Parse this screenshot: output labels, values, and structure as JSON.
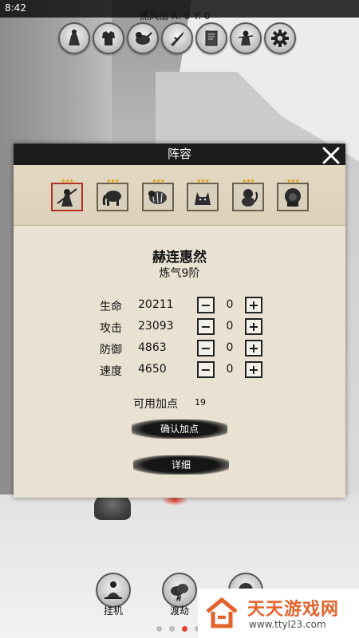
{
  "status": {
    "time": "8:42"
  },
  "map": {
    "location_label": "黑风山 X:  0 Y:  0"
  },
  "top_icons": [
    "hero-icon",
    "armor-icon",
    "beast-icon",
    "weapon-icon",
    "book-icon",
    "warrior-icon",
    "gear-icon"
  ],
  "panel": {
    "title": "阵容",
    "team": [
      {
        "name": "swordsman-icon",
        "stars": "★★★",
        "selected": true
      },
      {
        "name": "elephant-icon",
        "stars": "★★★",
        "selected": false
      },
      {
        "name": "tiger-icon",
        "stars": "★★★",
        "selected": false
      },
      {
        "name": "wolf-icon",
        "stars": "★★★",
        "selected": false
      },
      {
        "name": "monkey-icon",
        "stars": "★★★",
        "selected": false
      },
      {
        "name": "lion-icon",
        "stars": "★★★",
        "selected": false
      }
    ],
    "hero": {
      "name": "赫连惠然",
      "rank": "炼气9阶"
    },
    "stats": [
      {
        "label": "生命",
        "value": "20211",
        "added": "0"
      },
      {
        "label": "攻击",
        "value": "23093",
        "added": "0"
      },
      {
        "label": "防御",
        "value": "4863",
        "added": "0"
      },
      {
        "label": "速度",
        "value": "4650",
        "added": "0"
      }
    ],
    "minus_label": "−",
    "plus_label": "+",
    "points": {
      "label": "可用加点",
      "value": "19"
    },
    "confirm_label": "确认加点",
    "detail_label": "详细"
  },
  "bottom": {
    "idle_label": "挂机",
    "tribulation_label": "渡劫"
  },
  "pager": {
    "count": 5,
    "active": 3
  },
  "watermark": {
    "title": "天天游戏网",
    "url": "www.ttyl23.com"
  },
  "colors": {
    "accent": "#e4632d",
    "selected_border": "#b2322a",
    "star": "#d9a517"
  }
}
